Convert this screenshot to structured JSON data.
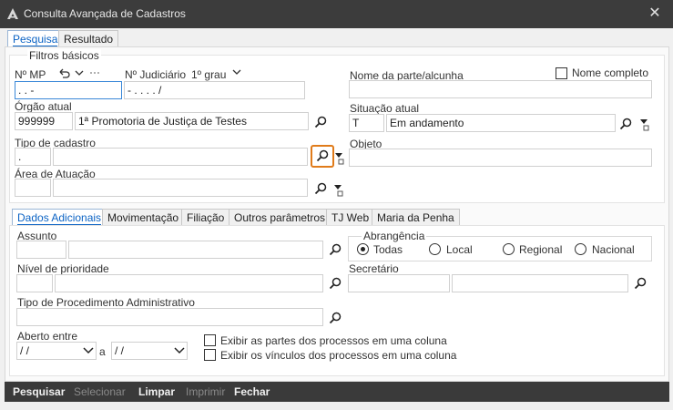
{
  "window": {
    "title": "Consulta Avançada de Cadastros",
    "close_glyph": "✕"
  },
  "tabs": {
    "pesquisa": "Pesquisa",
    "resultado": "Resultado"
  },
  "filtros": {
    "group_label": "Filtros básicos",
    "nmp_label": "Nº MP",
    "nmp_value": " .  .    -",
    "njud_label": "Nº Judiciário",
    "grau_label": "1º grau",
    "njud_value": "- .  . . .   /",
    "nome_label": "Nome da parte/alcunha",
    "nome_completo_label": "Nome completo",
    "orgao_label": "Órgão atual",
    "orgao_code": "999999",
    "orgao_name": "1ª Promotoria de Justiça de Testes",
    "situacao_label": "Situação atual",
    "situacao_code": "T",
    "situacao_name": "Em andamento",
    "tipo_label": "Tipo de cadastro",
    "tipo_code": ".",
    "objeto_label": "Objeto",
    "area_label": "Área de Atuação"
  },
  "subtabs": [
    "Dados Adicionais",
    "Movimentação",
    "Filiação",
    "Outros parâmetros",
    "TJ Web",
    "Maria da Penha"
  ],
  "adicionais": {
    "assunto_label": "Assunto",
    "abrangencia_label": "Abrangência",
    "radios": [
      "Todas",
      "Local",
      "Regional",
      "Nacional"
    ],
    "nivel_label": "Nível de prioridade",
    "secretario_label": "Secretário",
    "tipo_proc_label": "Tipo de Procedimento Administrativo",
    "aberto_label": "Aberto entre",
    "date_from": " / /",
    "date_sep": "a",
    "date_to": " / /",
    "exibir_partes": "Exibir as partes dos processos em uma coluna",
    "exibir_vinculos": "Exibir os vínculos dos processos em uma coluna"
  },
  "buttons": {
    "pesquisar": "Pesquisar",
    "selecionar": "Selecionar",
    "limpar": "Limpar",
    "imprimir": "Imprimir",
    "fechar": "Fechar"
  },
  "colors": {
    "titlebar": "#3c3c3c",
    "accent": "#0b63c4",
    "highlight": "#e07b1a"
  }
}
